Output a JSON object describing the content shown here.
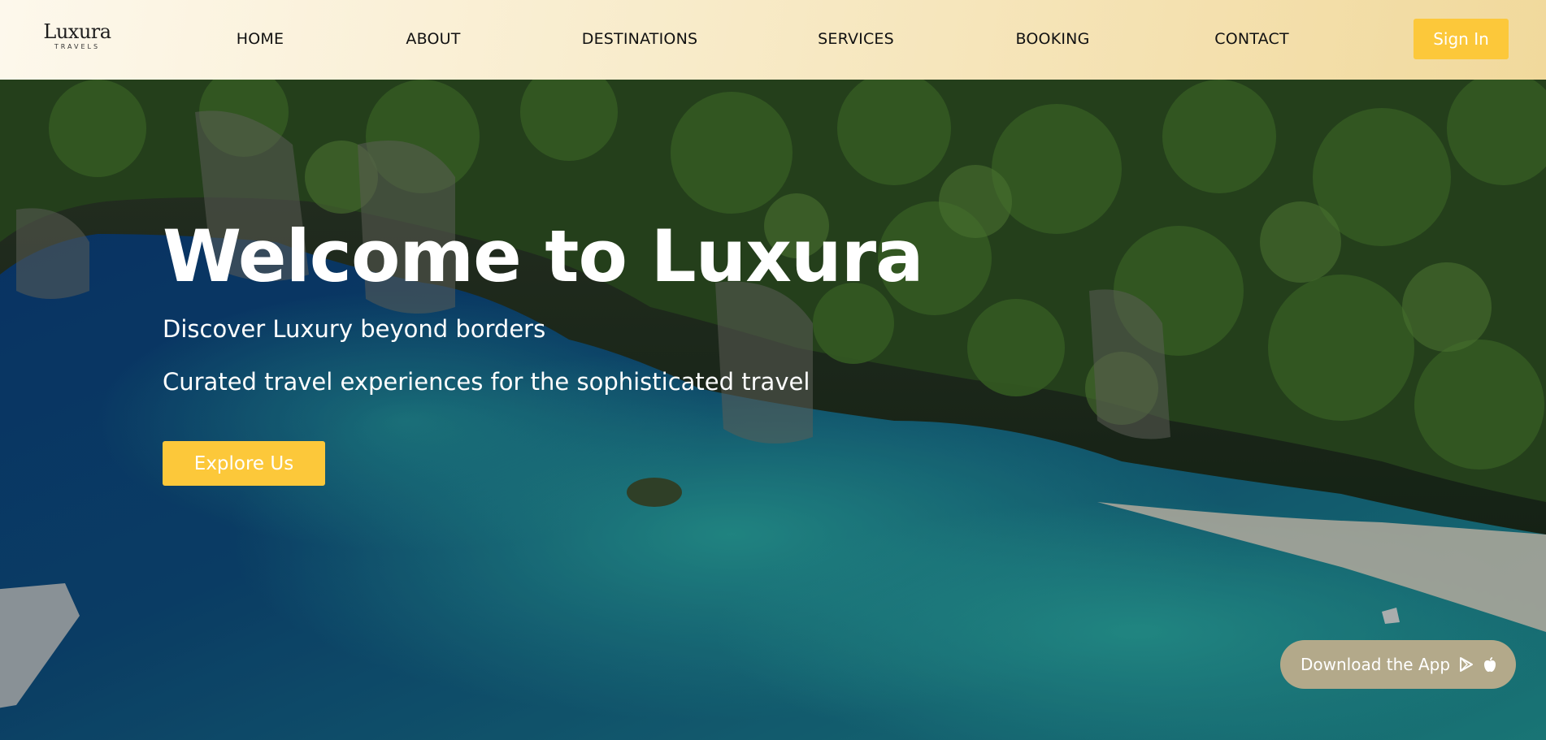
{
  "brand": {
    "name": "Luxura",
    "tagline": "TRAVELS"
  },
  "nav": {
    "home": "HOME",
    "about": "ABOUT",
    "destinations": "DESTINATIONS",
    "services": "SERVICES",
    "booking": "BOOKING",
    "contact": "CONTACT",
    "sign_in": "Sign In"
  },
  "hero": {
    "title": "Welcome to Luxura",
    "subtitle": "Discover Luxury beyond borders",
    "tagline": "Curated travel experiences for the sophisticated travel",
    "cta": "Explore Us"
  },
  "download": {
    "label": "Download the App",
    "icons": [
      "play-store-icon",
      "apple-icon"
    ]
  },
  "colors": {
    "accent": "#fcc83a",
    "header_start": "#fdf8ec",
    "header_end": "#f1d99c",
    "download_pill": "#b3a98a"
  }
}
